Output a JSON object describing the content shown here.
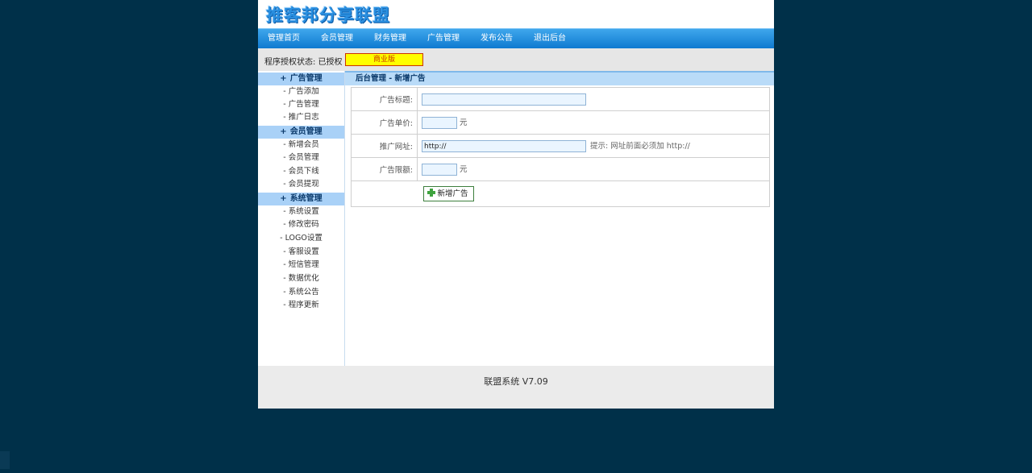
{
  "logo": {
    "text": "推客邦分享联盟"
  },
  "nav": {
    "items": [
      "管理首页",
      "会员管理",
      "财务管理",
      "广告管理",
      "发布公告",
      "退出后台"
    ]
  },
  "license": {
    "label": "程序授权状态: 已授权",
    "badge": "商业版"
  },
  "sidebar": {
    "groups": [
      {
        "title": "广告管理",
        "items": [
          "广告添加",
          "广告管理",
          "推广日志"
        ]
      },
      {
        "title": "会员管理",
        "items": [
          "新增会员",
          "会员管理",
          "会员下线",
          "会员提现"
        ]
      },
      {
        "title": "系统管理",
        "items": [
          "系统设置",
          "修改密码",
          "LOGO设置",
          "客服设置",
          "短信管理",
          "数据优化",
          "系统公告",
          "程序更新"
        ]
      }
    ],
    "plus": "+",
    "dash": "- "
  },
  "main": {
    "title": "后台管理 - 新增广告",
    "form": {
      "title_label": "广告标题:",
      "title_value": "",
      "price_label": "广告单价:",
      "price_value": "",
      "price_unit": "元",
      "url_label": "推广网址:",
      "url_value": "http://",
      "url_hint": "提示: 网址前面必须加 http://",
      "limit_label": "广告限额:",
      "limit_value": "",
      "limit_unit": "元",
      "submit_label": "新增广告"
    }
  },
  "footer": {
    "text": "联盟系统 V7.09"
  },
  "colors": {
    "page_bg": "#003049",
    "nav_blue": "#0d78cf",
    "sidebar_head": "#a9d1f7",
    "badge_yellow": "#ffff00"
  }
}
